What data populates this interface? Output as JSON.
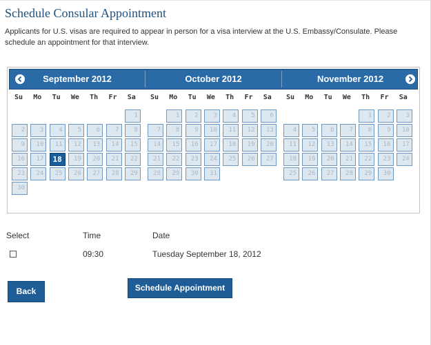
{
  "page": {
    "title": "Schedule Consular Appointment",
    "intro": "Applicants for U.S. visas are required to appear in person for a visa interview at the U.S. Embassy/Consulate. Please schedule an appointment for that interview."
  },
  "calendar": {
    "weekdays": [
      "Su",
      "Mo",
      "Tu",
      "We",
      "Th",
      "Fr",
      "Sa"
    ],
    "months": [
      {
        "name": "September 2012",
        "first_weekday": 6,
        "days": 30,
        "selected_day": 18
      },
      {
        "name": "October 2012",
        "first_weekday": 1,
        "days": 31,
        "selected_day": null
      },
      {
        "name": "November 2012",
        "first_weekday": 4,
        "days": 30,
        "selected_day": null
      }
    ],
    "prev_icon": "circle-arrow-left-icon",
    "next_icon": "circle-arrow-right-icon"
  },
  "slots": {
    "headers": {
      "select": "Select",
      "time": "Time",
      "date": "Date"
    },
    "rows": [
      {
        "checked": false,
        "time": "09:30",
        "date": "Tuesday September 18, 2012"
      }
    ]
  },
  "actions": {
    "back_label": "Back",
    "schedule_label": "Schedule Appointment"
  },
  "colors": {
    "accent": "#2a6aa6",
    "day_cell": "#dde7f0",
    "selected_day": "#185f9e",
    "title": "#1f4f7a"
  }
}
